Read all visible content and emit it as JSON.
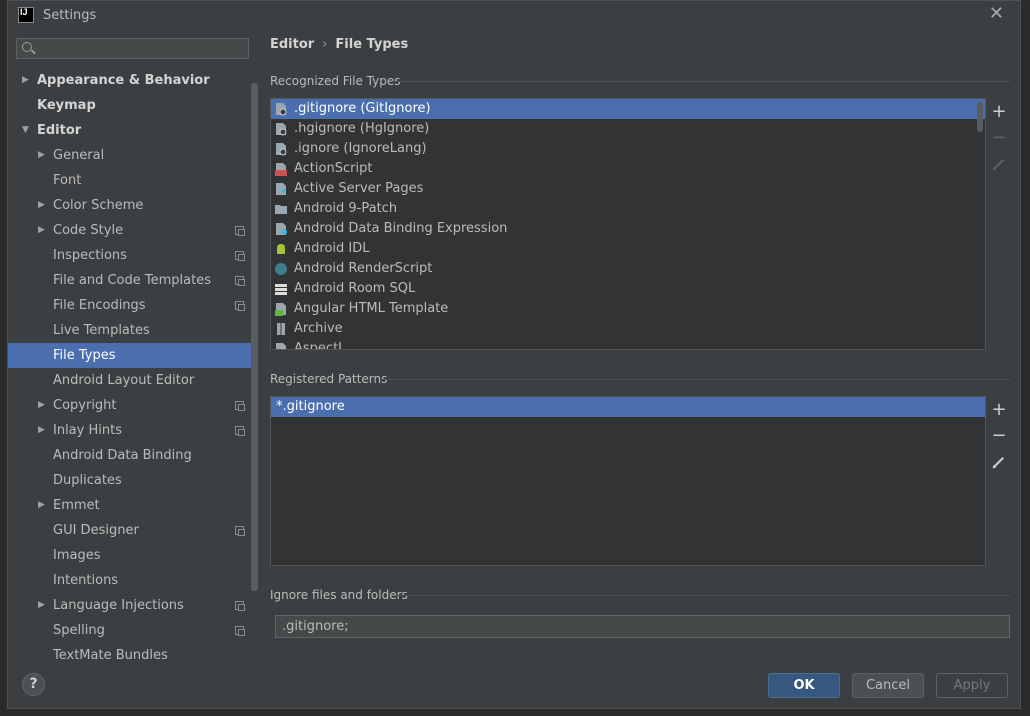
{
  "window": {
    "title": "Settings"
  },
  "search": {
    "placeholder": ""
  },
  "sidebar": {
    "items": [
      {
        "label": "Appearance & Behavior",
        "level": 0,
        "arrow": "right",
        "bold": true
      },
      {
        "label": "Keymap",
        "level": 0,
        "arrow": "",
        "bold": true
      },
      {
        "label": "Editor",
        "level": 0,
        "arrow": "down",
        "bold": true
      },
      {
        "label": "General",
        "level": 1,
        "arrow": "right"
      },
      {
        "label": "Font",
        "level": 1,
        "arrow": ""
      },
      {
        "label": "Color Scheme",
        "level": 1,
        "arrow": "right"
      },
      {
        "label": "Code Style",
        "level": 1,
        "arrow": "right",
        "project": true
      },
      {
        "label": "Inspections",
        "level": 1,
        "arrow": "",
        "project": true
      },
      {
        "label": "File and Code Templates",
        "level": 1,
        "arrow": "",
        "project": true
      },
      {
        "label": "File Encodings",
        "level": 1,
        "arrow": "",
        "project": true
      },
      {
        "label": "Live Templates",
        "level": 1,
        "arrow": ""
      },
      {
        "label": "File Types",
        "level": 1,
        "arrow": "",
        "selected": true
      },
      {
        "label": "Android Layout Editor",
        "level": 1,
        "arrow": ""
      },
      {
        "label": "Copyright",
        "level": 1,
        "arrow": "right",
        "project": true
      },
      {
        "label": "Inlay Hints",
        "level": 1,
        "arrow": "right",
        "project": true
      },
      {
        "label": "Android Data Binding",
        "level": 1,
        "arrow": ""
      },
      {
        "label": "Duplicates",
        "level": 1,
        "arrow": ""
      },
      {
        "label": "Emmet",
        "level": 1,
        "arrow": "right"
      },
      {
        "label": "GUI Designer",
        "level": 1,
        "arrow": "",
        "project": true
      },
      {
        "label": "Images",
        "level": 1,
        "arrow": ""
      },
      {
        "label": "Intentions",
        "level": 1,
        "arrow": ""
      },
      {
        "label": "Language Injections",
        "level": 1,
        "arrow": "right",
        "project": true
      },
      {
        "label": "Spelling",
        "level": 1,
        "arrow": "",
        "project": true
      },
      {
        "label": "TextMate Bundles",
        "level": 1,
        "arrow": ""
      }
    ]
  },
  "breadcrumb": {
    "parent": "Editor",
    "separator": "›",
    "current": "File Types"
  },
  "recognized": {
    "title": "Recognized File Types",
    "items": [
      {
        "label": ".gitignore (GitIgnore)",
        "icon": "ignore-file-icon",
        "selected": true
      },
      {
        "label": ".hgignore (HgIgnore)",
        "icon": "ignore-file-icon"
      },
      {
        "label": ".ignore (IgnoreLang)",
        "icon": "ignore-file-icon"
      },
      {
        "label": "ActionScript",
        "icon": "actionscript-icon"
      },
      {
        "label": "Active Server Pages",
        "icon": "asp-file-icon"
      },
      {
        "label": "Android 9-Patch",
        "icon": "folder-icon"
      },
      {
        "label": "Android Data Binding Expression",
        "icon": "data-binding-icon"
      },
      {
        "label": "Android IDL",
        "icon": "android-icon"
      },
      {
        "label": "Android RenderScript",
        "icon": "renderscript-icon"
      },
      {
        "label": "Android Room SQL",
        "icon": "room-sql-icon"
      },
      {
        "label": "Angular HTML Template",
        "icon": "angular-html-icon"
      },
      {
        "label": "Archive",
        "icon": "archive-icon"
      },
      {
        "label": "AspectJ",
        "icon": "ignore-file-icon"
      }
    ]
  },
  "patterns": {
    "title": "Registered Patterns",
    "items": [
      {
        "label": "*.gitignore",
        "selected": true
      }
    ]
  },
  "ignore": {
    "title": "Ignore files and folders",
    "value": ".gitignore;"
  },
  "buttons": {
    "help": "?",
    "ok": "OK",
    "cancel": "Cancel",
    "apply": "Apply"
  },
  "colors": {
    "selection": "#4b6eaf",
    "background": "#3c3f41",
    "ok": "#365880"
  }
}
